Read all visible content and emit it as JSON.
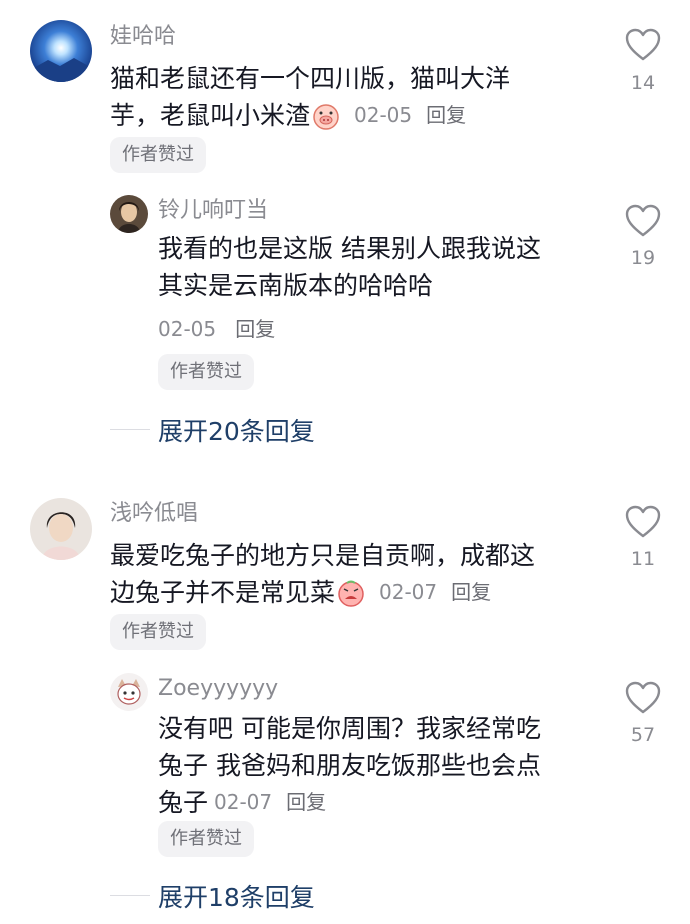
{
  "comments": [
    {
      "user": "娃哈哈",
      "lines": [
        "猫和老鼠还有一个四川版，猫叫大洋",
        "芋，老鼠叫小米渣"
      ],
      "emoji": "pig-face-emoji",
      "date": "02-05",
      "reply_label": "回复",
      "badge": "作者赞过",
      "likes": "14",
      "reply": {
        "user": "铃儿响叮当",
        "lines": [
          "我看的也是这版 结果别人跟我说这",
          "其实是云南版本的哈哈哈"
        ],
        "date": "02-05",
        "reply_label": "回复",
        "badge": "作者赞过",
        "likes": "19"
      },
      "expand_label": "展开20条回复"
    },
    {
      "user": "浅吟低唱",
      "lines": [
        "最爱吃兔子的地方只是自贡啊，成都这",
        "边兔子并不是常见菜"
      ],
      "emoji": "crying-face-emoji",
      "date": "02-07",
      "reply_label": "回复",
      "badge": "作者赞过",
      "likes": "11",
      "reply": {
        "user": "Zoeyyyyyy",
        "lines": [
          "没有吧 可能是你周围？我家经常吃",
          "兔子 我爸妈和朋友吃饭那些也会点",
          "兔子"
        ],
        "date": "02-07",
        "reply_label": "回复",
        "badge": "作者赞过",
        "likes": "57"
      },
      "expand_label": "展开18条回复"
    }
  ],
  "colors": {
    "name": "#8a8b91",
    "text": "#161823",
    "expand": "#1f3f68",
    "pill_bg": "#f2f2f4"
  }
}
